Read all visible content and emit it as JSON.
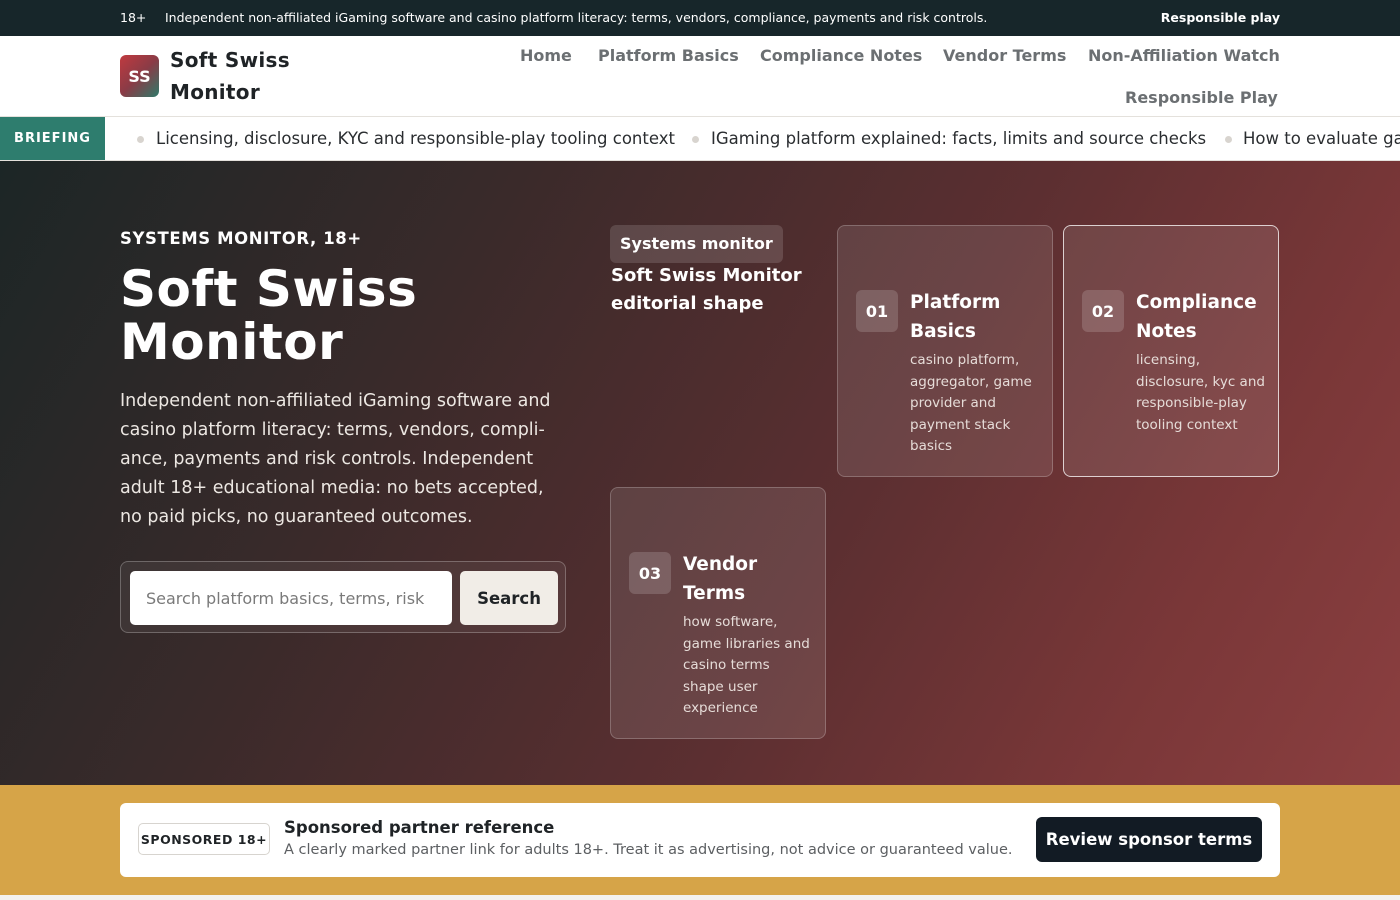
{
  "topstrip": {
    "age": "18+",
    "message": "Independent non-affiliated iGaming software and casino platform literacy: terms, vendors, compliance, payments and risk controls.",
    "responsible_link": "Responsible play"
  },
  "header": {
    "logo_initials": "SS",
    "brand_line1": "Soft Swiss",
    "brand_line2": "Monitor",
    "nav": [
      "Home",
      "Platform Basics",
      "Compliance Notes",
      "Vendor Terms",
      "Non-Affiliation Watch",
      "Responsible Play"
    ]
  },
  "briefing": {
    "tag": "BRIEFING",
    "items": [
      "Licensing, disclosure, KYC and responsible-play tooling context",
      "IGaming platform explained: facts, limits and source checks",
      "How to evaluate game libraries without promotional claims"
    ]
  },
  "hero": {
    "eyebrow": "SYSTEMS MONITOR, 18+",
    "title": "Soft Swiss Monitor",
    "description": "Independent non-affiliated iGaming software and casino platform literacy: terms, vendors, compli-ance, payments and risk controls. Independent adult 18+ educational media: no bets accepted, no paid picks, no guaranteed outcomes.",
    "search_placeholder": "Search platform basics, terms, risk",
    "search_button": "Search",
    "panel_pill": "Systems monitor",
    "panel_text": "Soft Swiss Monitor editorial shape",
    "cards": [
      {
        "num": "01",
        "title": "Platform Basics",
        "desc": "casino platform, aggregator, game provider and payment stack basics"
      },
      {
        "num": "02",
        "title": "Compliance Notes",
        "desc": "licensing, disclosure, kyc and responsible-play tooling context"
      },
      {
        "num": "03",
        "title": "Vendor Terms",
        "desc": "how software, game libraries and casino terms shape user experience"
      }
    ]
  },
  "sponsor": {
    "badge": "SPONSORED 18+",
    "title": "Sponsored partner reference",
    "description": "A clearly marked partner link for adults 18+. Treat it as advertising, not advice or guaranteed value.",
    "button": "Review sponsor terms"
  },
  "colors": {
    "topbar": "#17262a",
    "briefing_tag": "#2e7d6e",
    "sponsor_band": "#d6a448",
    "sponsor_button": "#121b24"
  }
}
